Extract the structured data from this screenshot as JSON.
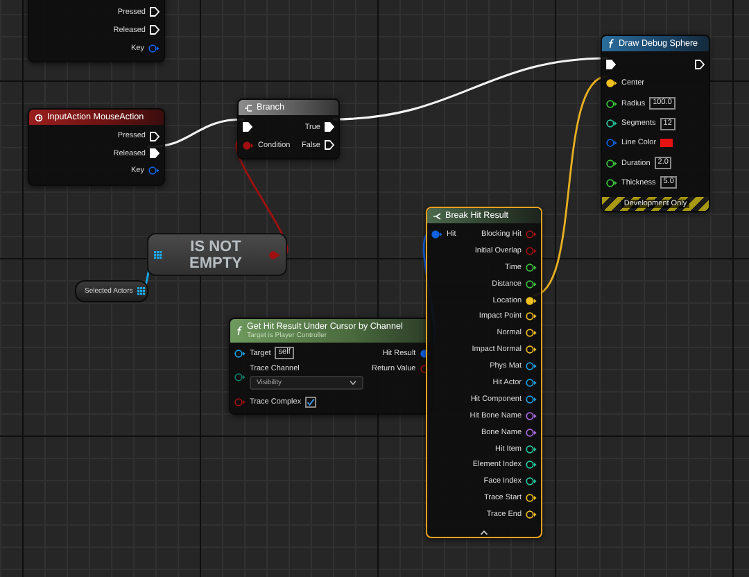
{
  "nodes": [
    {
      "kind": "event",
      "selected": false,
      "outputs": [
        {
          "label": "Pressed",
          "kind": "exec",
          "connected": false
        },
        {
          "label": "Released",
          "kind": "exec",
          "connected": false
        },
        {
          "label": "Key",
          "kind": "struct",
          "connected": false
        }
      ]
    },
    {
      "kind": "event",
      "title": "InputAction MouseAction",
      "selected": false,
      "outputs": [
        {
          "label": "Pressed",
          "kind": "exec",
          "connected": false
        },
        {
          "label": "Released",
          "kind": "exec",
          "connected": true
        },
        {
          "label": "Key",
          "kind": "struct",
          "connected": false
        }
      ]
    },
    {
      "kind": "flow",
      "title": "Branch",
      "selected": false,
      "inputs": [
        {
          "kind": "exec",
          "connected": true
        },
        {
          "label": "Condition",
          "kind": "bool",
          "connected": true
        }
      ],
      "outputs": [
        {
          "label": "True",
          "kind": "exec",
          "connected": true
        },
        {
          "label": "False",
          "kind": "exec",
          "connected": false
        }
      ]
    },
    {
      "kind": "function",
      "title": "Draw Debug Sphere",
      "footer": "Development Only",
      "selected": false,
      "inputs": [
        {
          "kind": "exec",
          "connected": true
        },
        {
          "label": "Center",
          "kind": "vector",
          "connected": true
        },
        {
          "label": "Radius",
          "kind": "float",
          "connected": false,
          "value": "100.0"
        },
        {
          "label": "Segments",
          "kind": "int",
          "connected": false,
          "value": "12"
        },
        {
          "label": "Line Color",
          "kind": "struct",
          "connected": false,
          "color": "#e51212"
        },
        {
          "label": "Duration",
          "kind": "float",
          "connected": false,
          "value": "2.0"
        },
        {
          "label": "Thickness",
          "kind": "float",
          "connected": false,
          "value": "5.0"
        }
      ],
      "outputs": [
        {
          "kind": "exec",
          "connected": false
        }
      ]
    },
    {
      "kind": "compact",
      "title": "IS NOT EMPTY",
      "selected": false,
      "inputs": [
        {
          "kind": "array",
          "connected": true
        }
      ],
      "outputs": [
        {
          "kind": "bool",
          "connected": true
        }
      ]
    },
    {
      "kind": "variable",
      "title": "Selected Actors",
      "selected": false,
      "outputs": [
        {
          "kind": "array",
          "connected": true
        }
      ]
    },
    {
      "kind": "pure",
      "title": "Get Hit Result Under Cursor by Channel",
      "subtitle": "Target is Player Controller",
      "selected": false,
      "inputs": [
        {
          "label": "Target",
          "kind": "object",
          "connected": false,
          "value": "self"
        },
        {
          "label": "Trace Channel",
          "kind": "byte",
          "connected": false,
          "dropdown": true,
          "value": "Visibility"
        },
        {
          "label": "Trace Complex",
          "kind": "bool",
          "connected": false,
          "checked": true
        }
      ],
      "outputs": [
        {
          "label": "Hit Result",
          "kind": "struct",
          "connected": true
        },
        {
          "label": "Return Value",
          "kind": "bool",
          "connected": false
        }
      ]
    },
    {
      "kind": "break",
      "title": "Break Hit Result",
      "selected": true,
      "inputs": [
        {
          "label": "Hit",
          "kind": "struct",
          "connected": true
        }
      ],
      "outputs": [
        {
          "label": "Blocking Hit",
          "kind": "bool",
          "connected": false
        },
        {
          "label": "Initial Overlap",
          "kind": "bool",
          "connected": false
        },
        {
          "label": "Time",
          "kind": "float",
          "connected": false
        },
        {
          "label": "Distance",
          "kind": "float",
          "connected": false
        },
        {
          "label": "Location",
          "kind": "vector",
          "connected": true
        },
        {
          "label": "Impact Point",
          "kind": "vector",
          "connected": false
        },
        {
          "label": "Normal",
          "kind": "vector",
          "connected": false
        },
        {
          "label": "Impact Normal",
          "kind": "vector",
          "connected": false
        },
        {
          "label": "Phys Mat",
          "kind": "object",
          "connected": false
        },
        {
          "label": "Hit Actor",
          "kind": "object",
          "connected": false
        },
        {
          "label": "Hit Component",
          "kind": "object",
          "connected": false
        },
        {
          "label": "Hit Bone Name",
          "kind": "name",
          "connected": false
        },
        {
          "label": "Bone Name",
          "kind": "name",
          "connected": false
        },
        {
          "label": "Hit Item",
          "kind": "int",
          "connected": false
        },
        {
          "label": "Element Index",
          "kind": "int",
          "connected": false
        },
        {
          "label": "Face Index",
          "kind": "int",
          "connected": false
        },
        {
          "label": "Trace Start",
          "kind": "vector",
          "connected": false
        },
        {
          "label": "Trace End",
          "kind": "vector",
          "connected": false
        }
      ]
    }
  ]
}
